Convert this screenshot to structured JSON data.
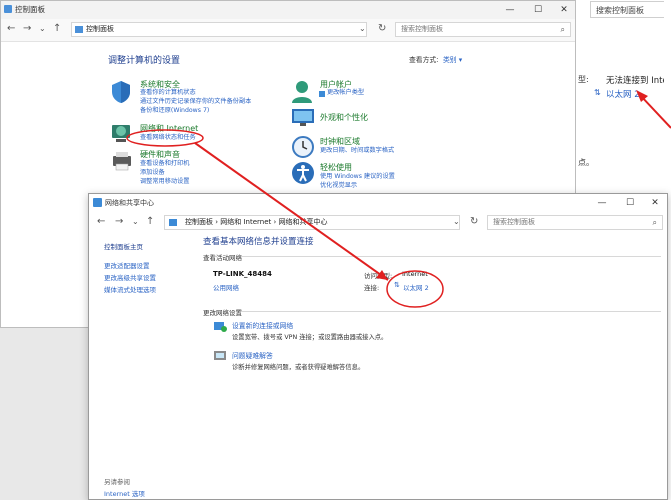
{
  "control_panel": {
    "title": "控制面板",
    "breadcrumb": "控制面板",
    "search_placeholder": "搜索控制面板",
    "heading": "调整计算机的设置",
    "view_by_label": "查看方式:",
    "view_by_value": "类别",
    "categories": [
      {
        "title": "系统和安全",
        "links": [
          "查看你的计算机状态",
          "通过文件历史记录保存你的文件备份副本",
          "备份和还原(Windows 7)"
        ]
      },
      {
        "title": "网络和 Internet",
        "links": [
          "查看网络状态和任务"
        ]
      },
      {
        "title": "硬件和声音",
        "links": [
          "查看设备和打印机",
          "添加设备",
          "调整常用移动设置"
        ]
      },
      {
        "title": "用户帐户",
        "links": [
          "更改帐户类型"
        ]
      },
      {
        "title": "外观和个性化",
        "links": []
      },
      {
        "title": "时钟和区域",
        "links": [
          "更改日期、时间或数字格式"
        ]
      },
      {
        "title": "轻松使用",
        "links": [
          "使用 Windows 建议的设置",
          "优化视觉显示"
        ]
      }
    ]
  },
  "background_window": {
    "search_placeholder": "搜索控制面板",
    "type_label": "型:",
    "status": "无法连接到 Inter",
    "connection": "以太网 2",
    "fragment": "点。"
  },
  "network_window": {
    "title": "网络和共享中心",
    "breadcrumb": [
      "控制面板",
      "网络和 Internet",
      "网络和共享中心"
    ],
    "search_placeholder": "搜索控制面板",
    "sidebar": {
      "links": [
        "控制面板主页",
        "更改适配器设置",
        "更改高级共享设置",
        "媒体流式处理选项"
      ],
      "see_also_label": "另请参阅",
      "see_also_links": [
        "Internet 选项"
      ]
    },
    "heading": "查看基本网络信息并设置连接",
    "active_networks_label": "查看活动网络",
    "network_name": "TP-LINK_48484",
    "network_type": "公用网络",
    "access_type_label": "访问类型:",
    "access_type_value": "Internet",
    "connections_label": "连接:",
    "connection_value": "以太网 2",
    "change_settings_label": "更改网络设置",
    "actions": [
      {
        "title": "设置新的连接或网络",
        "desc": "设置宽带、拨号或 VPN 连接；或设置路由器或接入点。"
      },
      {
        "title": "问题疑难解答",
        "desc": "诊断并修复网络问题，或者获得疑难解答信息。"
      }
    ]
  },
  "colors": {
    "link": "#2a63c4",
    "category_green": "#1b7a2c",
    "annotation_red": "#e02020"
  }
}
